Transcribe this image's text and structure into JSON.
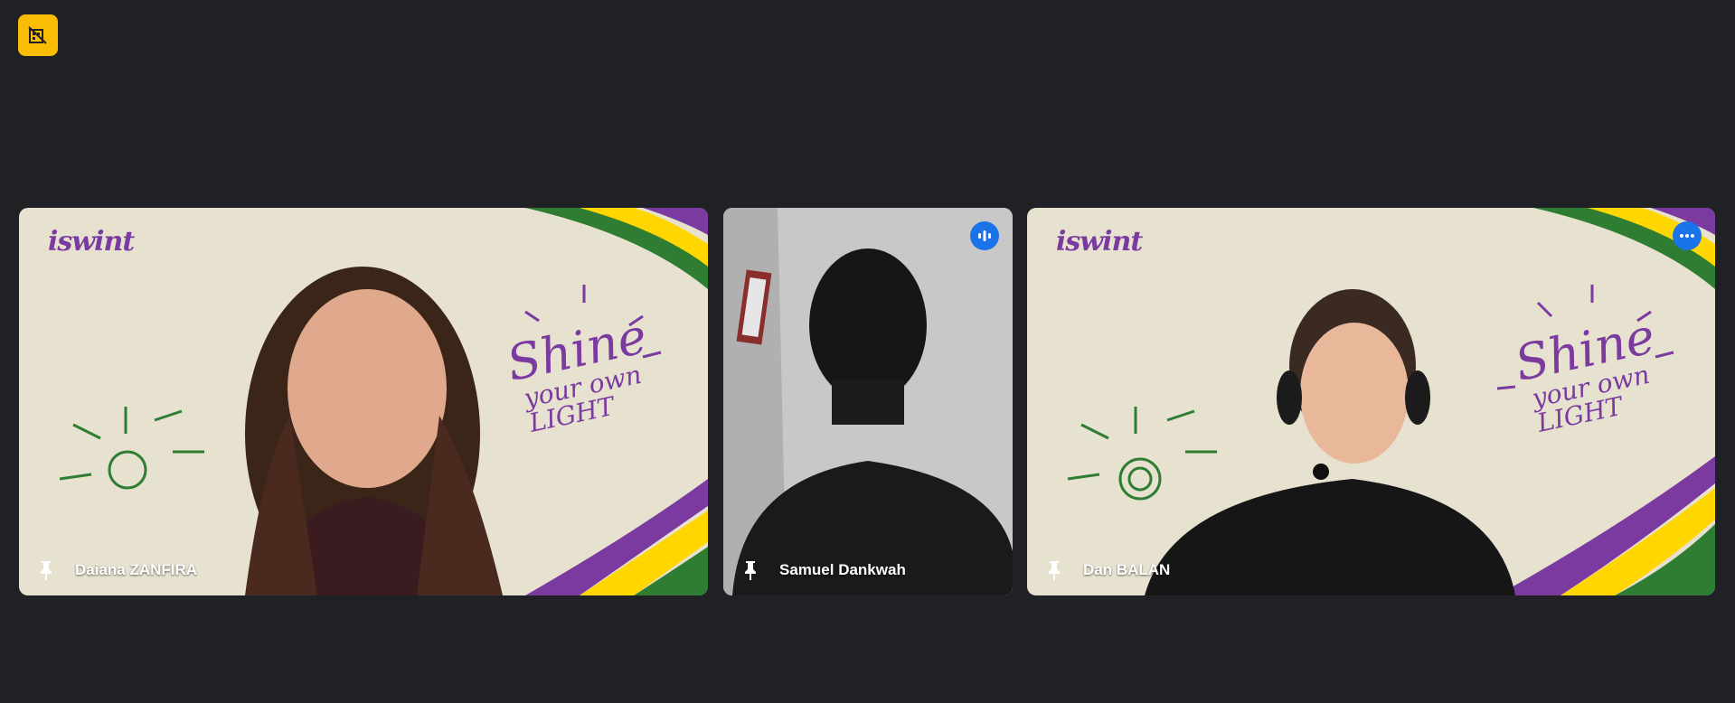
{
  "meeting": {
    "status_icon": "no-video-building-icon",
    "accent_color": "#fbbc04"
  },
  "participants": [
    {
      "name": "Daiana ZANFIRA",
      "logo_text": "iswint",
      "tagline_line1": "Shine",
      "tagline_line2": "your own",
      "tagline_line3": "LIGHT"
    },
    {
      "name": "Samuel Dankwah",
      "indicator_icon": "audio-level-icon"
    },
    {
      "name": "Dan BALAN",
      "logo_text": "iswint",
      "tagline_line1": "Shine",
      "tagline_line2": "your own",
      "tagline_line3": "LIGHT",
      "indicator_icon": "more-options-icon"
    }
  ],
  "colors": {
    "background": "#202124",
    "purple": "#7b3aa0",
    "yellow": "#ffd600",
    "green": "#2e7d32",
    "button_blue": "#1a73e8"
  }
}
